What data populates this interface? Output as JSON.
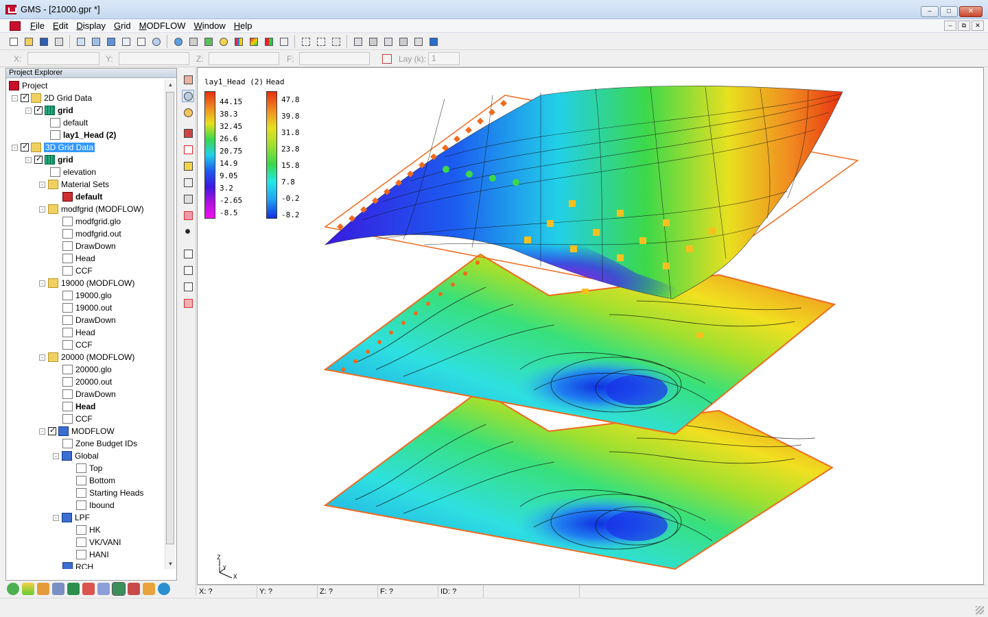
{
  "window": {
    "title": "GMS - [21000.gpr *]"
  },
  "menu": [
    "File",
    "Edit",
    "Display",
    "Grid",
    "MODFLOW",
    "Window",
    "Help"
  ],
  "coordbar": {
    "x_label": "X:",
    "y_label": "Y:",
    "z_label": "Z:",
    "f_label": "F:",
    "lay_label": "Lay (k):",
    "lay_value": "1"
  },
  "explorer": {
    "title": "Project Explorer",
    "nodes": [
      {
        "label": "Project"
      },
      {
        "label": "2D Grid Data"
      },
      {
        "label": "grid"
      },
      {
        "label": "default"
      },
      {
        "label": "lay1_Head (2)"
      },
      {
        "label": "3D Grid Data"
      },
      {
        "label": "grid"
      },
      {
        "label": "elevation"
      },
      {
        "label": "Material Sets"
      },
      {
        "label": "default"
      },
      {
        "label": "modfgrid (MODFLOW)"
      },
      {
        "label": "modfgrid.glo"
      },
      {
        "label": "modfgrid.out"
      },
      {
        "label": "DrawDown"
      },
      {
        "label": "Head"
      },
      {
        "label": "CCF"
      },
      {
        "label": "19000 (MODFLOW)"
      },
      {
        "label": "19000.glo"
      },
      {
        "label": "19000.out"
      },
      {
        "label": "DrawDown"
      },
      {
        "label": "Head"
      },
      {
        "label": "CCF"
      },
      {
        "label": "20000 (MODFLOW)"
      },
      {
        "label": "20000.glo"
      },
      {
        "label": "20000.out"
      },
      {
        "label": "DrawDown"
      },
      {
        "label": "Head"
      },
      {
        "label": "CCF"
      },
      {
        "label": "MODFLOW"
      },
      {
        "label": "Zone Budget IDs"
      },
      {
        "label": "Global"
      },
      {
        "label": "Top"
      },
      {
        "label": "Bottom"
      },
      {
        "label": "Starting Heads"
      },
      {
        "label": "Ibound"
      },
      {
        "label": "LPF"
      },
      {
        "label": "HK"
      },
      {
        "label": "VK/VANI"
      },
      {
        "label": "HANI"
      },
      {
        "label": "RCH"
      }
    ]
  },
  "legend1": {
    "title": "lay1_Head (2)",
    "ticks": [
      "44.15",
      "38.3",
      "32.45",
      "26.6",
      "20.75",
      "14.9",
      "9.05",
      "3.2",
      "-2.65",
      "-8.5"
    ]
  },
  "legend2": {
    "title": "Head",
    "ticks": [
      "47.8",
      "39.8",
      "31.8",
      "23.8",
      "15.8",
      "7.8",
      "-0.2",
      "-8.2"
    ]
  },
  "axes": {
    "z": "Z",
    "y": "Y",
    "x": "X"
  },
  "status": {
    "x": "X: ?",
    "y": "Y: ?",
    "z": "Z: ?",
    "f": "F: ?",
    "id": "ID: ?"
  },
  "colors": {
    "selection": "#3399ff",
    "boundary": "#f06a1c",
    "source_point": "#ffcc00",
    "well_point": "#00cc44"
  }
}
